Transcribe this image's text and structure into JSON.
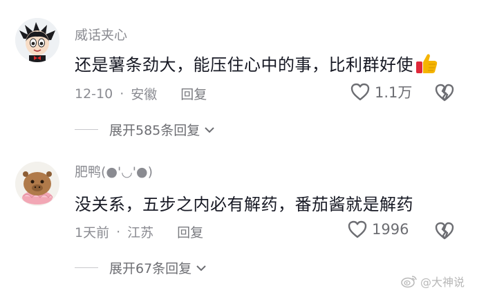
{
  "comments": [
    {
      "username": "威话夹心",
      "text": "还是薯条劲大，能压住心中的事，比利群好使",
      "date": "12-10",
      "separator": "·",
      "location": "安徽",
      "reply_label": "回复",
      "likes": "1.1万",
      "expand_label": "展开585条回复",
      "avatar_icon": "astro-boy-avatar-icon",
      "emoji": "thumbs-up-icon"
    },
    {
      "username": "肥鸭(●'◡'●)",
      "text": "没关系，五步之内必有解药，番茄酱就是解药",
      "date": "1天前",
      "separator": "·",
      "location": "江苏",
      "reply_label": "回复",
      "likes": "1996",
      "expand_label": "展开67条回复",
      "avatar_icon": "capybara-avatar-icon"
    }
  ],
  "watermark": {
    "text": "@大神说",
    "icon": "weibo-icon"
  },
  "colors": {
    "text": "#161823",
    "muted": "#8a8b91",
    "thumb": "#f5b400",
    "thumb_cuff": "#e0283a"
  }
}
